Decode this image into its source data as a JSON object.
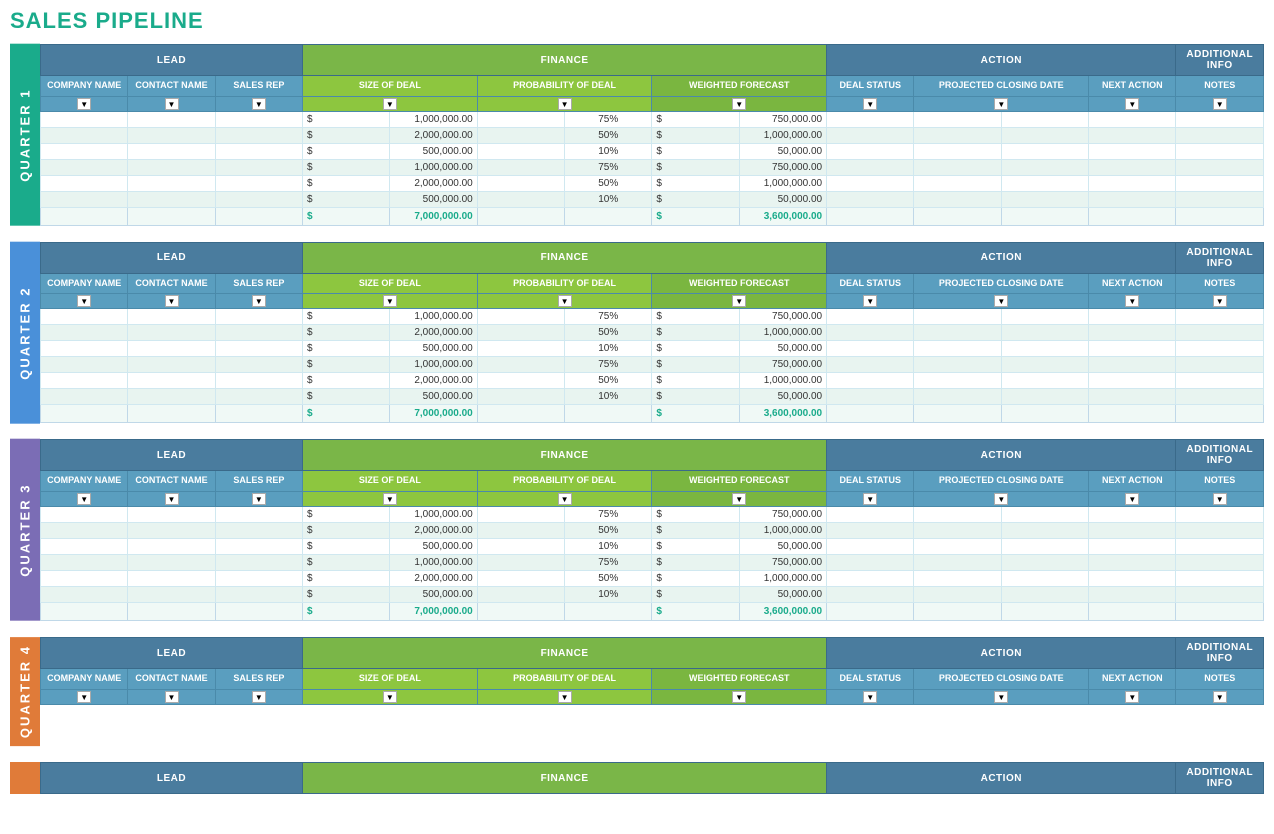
{
  "page": {
    "title": "SALES PIPELINE"
  },
  "colors": {
    "q1": "#1aab8b",
    "q2": "#4a90d9",
    "q3": "#7b6db5",
    "q4": "#e07b39",
    "teal_header": "#4a7c9e",
    "green_finance": "#8dc63f",
    "weighted_green": "#7ab640"
  },
  "sections": {
    "lead": "LEAD",
    "finance": "FINANCE",
    "action": "ACTION",
    "additional_info": "ADDITIONAL INFO"
  },
  "columns": {
    "company_name": "COMPANY NAME",
    "contact_name": "CONTACT NAME",
    "sales_rep": "SALES REP",
    "size_of_deal": "SIZE OF DEAL",
    "probability_of_deal": "PROBABILITY OF DEAL",
    "weighted_forecast": "WEIGHTED FORECAST",
    "deal_status": "DEAL STATUS",
    "projected_closing_date": "PROJECTED CLOSING DATE",
    "next_action": "NEXT ACTION",
    "notes": "NOTES"
  },
  "quarters": [
    {
      "label": "QUARTER 1",
      "color_class": "q1-color",
      "rows": [
        {
          "deal": "1,000,000.00",
          "prob": "75%",
          "weighted": "750,000.00"
        },
        {
          "deal": "2,000,000.00",
          "prob": "50%",
          "weighted": "1,000,000.00"
        },
        {
          "deal": "500,000.00",
          "prob": "10%",
          "weighted": "50,000.00"
        },
        {
          "deal": "1,000,000.00",
          "prob": "75%",
          "weighted": "750,000.00"
        },
        {
          "deal": "2,000,000.00",
          "prob": "50%",
          "weighted": "1,000,000.00"
        },
        {
          "deal": "500,000.00",
          "prob": "10%",
          "weighted": "50,000.00"
        }
      ],
      "total_deal": "7,000,000.00",
      "total_weighted": "3,600,000.00"
    },
    {
      "label": "QUARTER 2",
      "color_class": "q2-color",
      "rows": [
        {
          "deal": "1,000,000.00",
          "prob": "75%",
          "weighted": "750,000.00"
        },
        {
          "deal": "2,000,000.00",
          "prob": "50%",
          "weighted": "1,000,000.00"
        },
        {
          "deal": "500,000.00",
          "prob": "10%",
          "weighted": "50,000.00"
        },
        {
          "deal": "1,000,000.00",
          "prob": "75%",
          "weighted": "750,000.00"
        },
        {
          "deal": "2,000,000.00",
          "prob": "50%",
          "weighted": "1,000,000.00"
        },
        {
          "deal": "500,000.00",
          "prob": "10%",
          "weighted": "50,000.00"
        }
      ],
      "total_deal": "7,000,000.00",
      "total_weighted": "3,600,000.00"
    },
    {
      "label": "QUARTER 3",
      "color_class": "q3-color",
      "rows": [
        {
          "deal": "1,000,000.00",
          "prob": "75%",
          "weighted": "750,000.00"
        },
        {
          "deal": "2,000,000.00",
          "prob": "50%",
          "weighted": "1,000,000.00"
        },
        {
          "deal": "500,000.00",
          "prob": "10%",
          "weighted": "50,000.00"
        },
        {
          "deal": "1,000,000.00",
          "prob": "75%",
          "weighted": "750,000.00"
        },
        {
          "deal": "2,000,000.00",
          "prob": "50%",
          "weighted": "1,000,000.00"
        },
        {
          "deal": "500,000.00",
          "prob": "10%",
          "weighted": "50,000.00"
        }
      ],
      "total_deal": "7,000,000.00",
      "total_weighted": "3,600,000.00"
    },
    {
      "label": "QUARTER 4",
      "color_class": "q4-color",
      "rows": [],
      "total_deal": "",
      "total_weighted": ""
    }
  ]
}
